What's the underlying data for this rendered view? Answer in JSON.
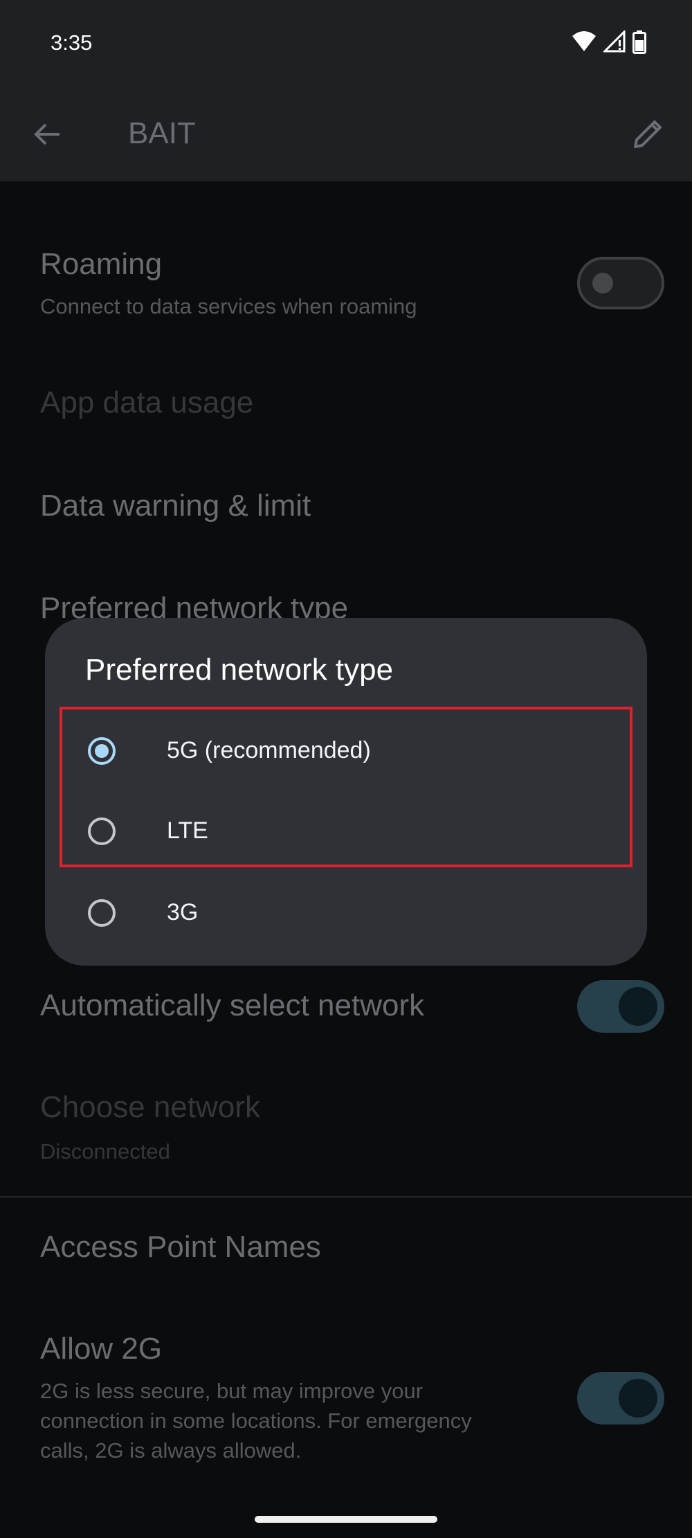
{
  "status_bar": {
    "time": "3:35",
    "icons": [
      "wifi-icon",
      "cell-signal-icon",
      "battery-icon"
    ]
  },
  "app_bar": {
    "title": "BAIT",
    "back_icon": "arrow-back-icon",
    "edit_icon": "pencil-icon"
  },
  "settings": {
    "roaming": {
      "title": "Roaming",
      "subtitle": "Connect to data services when roaming",
      "enabled": false
    },
    "app_data_usage": {
      "title": "App data usage"
    },
    "data_warning": {
      "title": "Data warning & limit"
    },
    "preferred_network": {
      "title": "Preferred network type"
    },
    "auto_select": {
      "title": "Automatically select network",
      "enabled": true
    },
    "choose_network": {
      "title": "Choose network",
      "subtitle": "Disconnected"
    },
    "apn": {
      "title": "Access Point Names"
    },
    "allow_2g": {
      "title": "Allow 2G",
      "subtitle_lines": [
        "2G is less secure, but may improve your",
        "connection in some locations. For emergency",
        "calls, 2G is always allowed."
      ],
      "enabled": true
    }
  },
  "dialog": {
    "title": "Preferred network type",
    "options": [
      {
        "label": "5G (recommended)",
        "selected": true
      },
      {
        "label": "LTE",
        "selected": false
      },
      {
        "label": "3G",
        "selected": false
      }
    ]
  },
  "colors": {
    "highlight": "#e0202b",
    "radio_selected": "#a9d8f8",
    "dialog_bg": "#2f3137"
  }
}
